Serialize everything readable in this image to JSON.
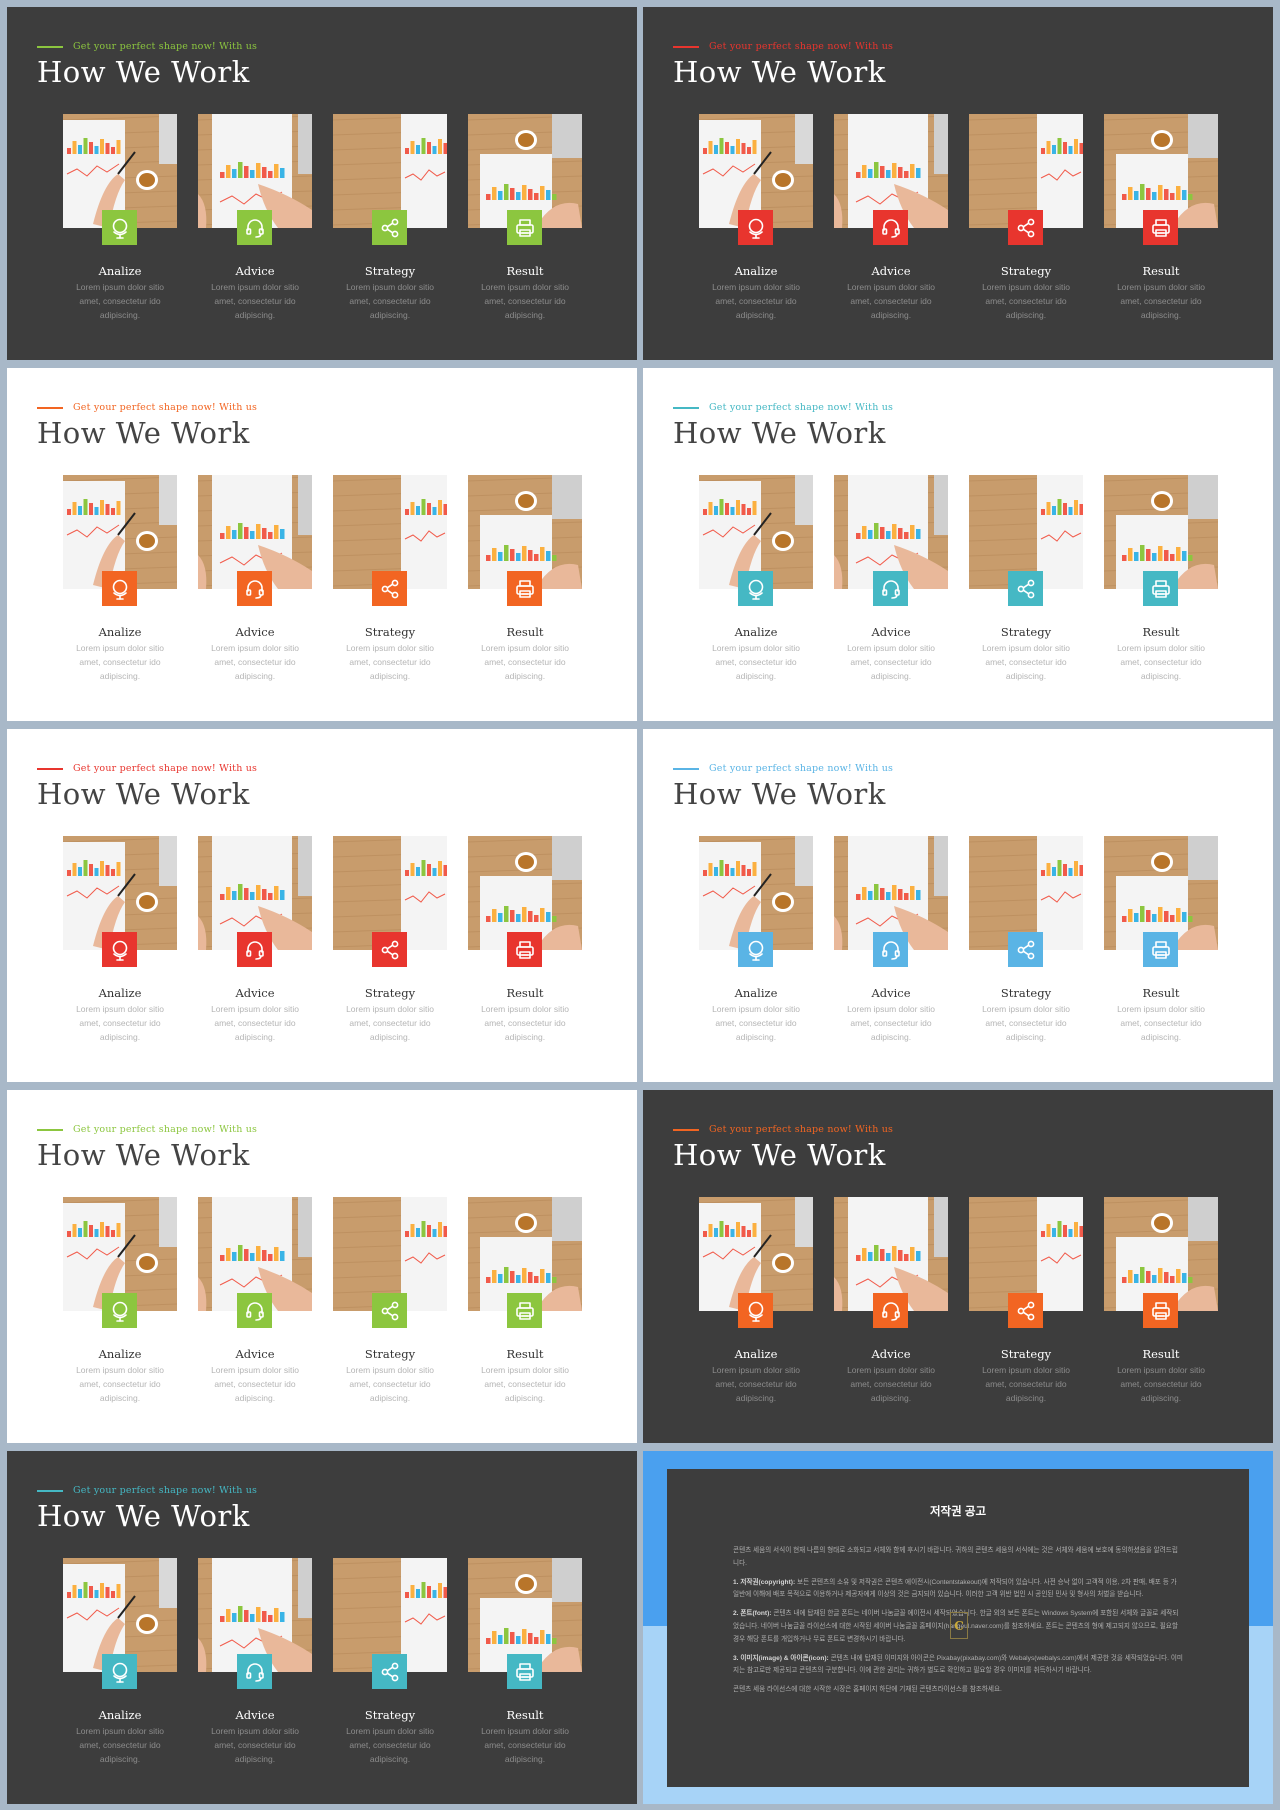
{
  "slides": [
    {
      "theme": "dark",
      "accent": "#8cc63f",
      "tagline": "Get your perfect shape now! With us",
      "title": "How We Work"
    },
    {
      "theme": "dark",
      "accent": "#e8352e",
      "tagline": "Get your perfect shape now! With us",
      "title": "How We Work"
    },
    {
      "theme": "light",
      "accent": "#f26522",
      "tagline": "Get your perfect shape now! With us",
      "title": "How We Work"
    },
    {
      "theme": "light",
      "accent": "#45b8c4",
      "tagline": "Get your perfect shape now! With us",
      "title": "How We Work"
    },
    {
      "theme": "light",
      "accent": "#e8352e",
      "tagline": "Get your perfect shape now! With us",
      "title": "How We Work"
    },
    {
      "theme": "light",
      "accent": "#5ab4e5",
      "tagline": "Get your perfect shape now! With us",
      "title": "How We Work"
    },
    {
      "theme": "light",
      "accent": "#8cc63f",
      "tagline": "Get your perfect shape now! With us",
      "title": "How We Work"
    },
    {
      "theme": "dark",
      "accent": "#f26522",
      "tagline": "Get your perfect shape now! With us",
      "title": "How We Work"
    },
    {
      "theme": "dark",
      "accent": "#45b8c4",
      "tagline": "Get your perfect shape now! With us",
      "title": "How We Work"
    }
  ],
  "cards": [
    {
      "title": "Analize",
      "desc": "Lorem ipsum dolor sitio\namet, consectetur ido\nadipiscing.",
      "icon": "globe-icon",
      "photo": "hand-pen-chart"
    },
    {
      "title": "Advice",
      "desc": "Lorem ipsum dolor sitio\namet, consectetur ido\nadipiscing.",
      "icon": "headset-icon",
      "photo": "hands-chart-paper"
    },
    {
      "title": "Strategy",
      "desc": "Lorem ipsum dolor sitio\namet, consectetur ido\nadipiscing.",
      "icon": "share-icon",
      "photo": "chart-paper-desk"
    },
    {
      "title": "Result",
      "desc": "Lorem ipsum dolor sitio\namet, consectetur ido\nadipiscing.",
      "icon": "printer-icon",
      "photo": "laptop-coffee-chart"
    }
  ],
  "notice": {
    "title": "저작권 공고",
    "intro": "콘텐츠 세움의 서식이 현재 나름의 형태로 소화되고 서체와 함께 후시기 바랍니다. 귀하의 콘텐츠 세움의 서식에는 것은 서체와 세움에 보호에 동의하셨음을 알려드립니다.",
    "sections": [
      {
        "head": "1. 저작권(copyright):",
        "text": "보든 콘텐츠의 소유 및 저작권은 콘텐츠 에이전시(Contentstakeout)에 저작되어 있습니다. 사전 승낙 없이 고객적 이용, 2차 판매, 배포 등 가 일반에 이해에 배포 목적으로 이용하거나 제공자에게 이상의 것은 금지되어 있습니다. 이러한 고객 위반 법인 시 공인된 민사 및 형사의 처벌을 받습니다."
      },
      {
        "head": "2. 폰트(font):",
        "text": "콘텐츠 내에 탑재된 한글 폰트는 네이버 나눔글꼴 에이전시 세작되었습니다. 한글 외의 보든 폰트는 Windows System에 포함된 서체와 글꼴로 세작되었습니다. 네이버 나눔글꼴 라이선스에 대한 시작된 세이버 나눔글꼴 홈페이지(hangeul.naver.com)를 참조하세요. 폰트는 콘텐츠의 형에 제고되지 않으므로, 필요할 경우 해당 폰트를 개입하거나 무료 폰트로 변경하시기 바랍니다."
      },
      {
        "head": "3. 이미지(image) & 아이콘(icon):",
        "text": "콘텐츠 내에 탑재된 이미지와 아이콘은 Pixabay(pixabay.com)와 Webalys(webalys.com)에서 제공한 것을 세작되었습니다. 이미지는 참고로만 제공되고 콘텐츠의 구분합니다. 이에 관한 권리는 귀하가 별도로 확인하고 필요할 경우 이미지를 취득하시기 바랍니다."
      }
    ],
    "outro": "콘텐츠 세움 라이선스에 대한 시작한 시장은 홈페이지 하단에 기재된 콘텐츠라이선스를 참조하세요.",
    "logo": "C"
  }
}
